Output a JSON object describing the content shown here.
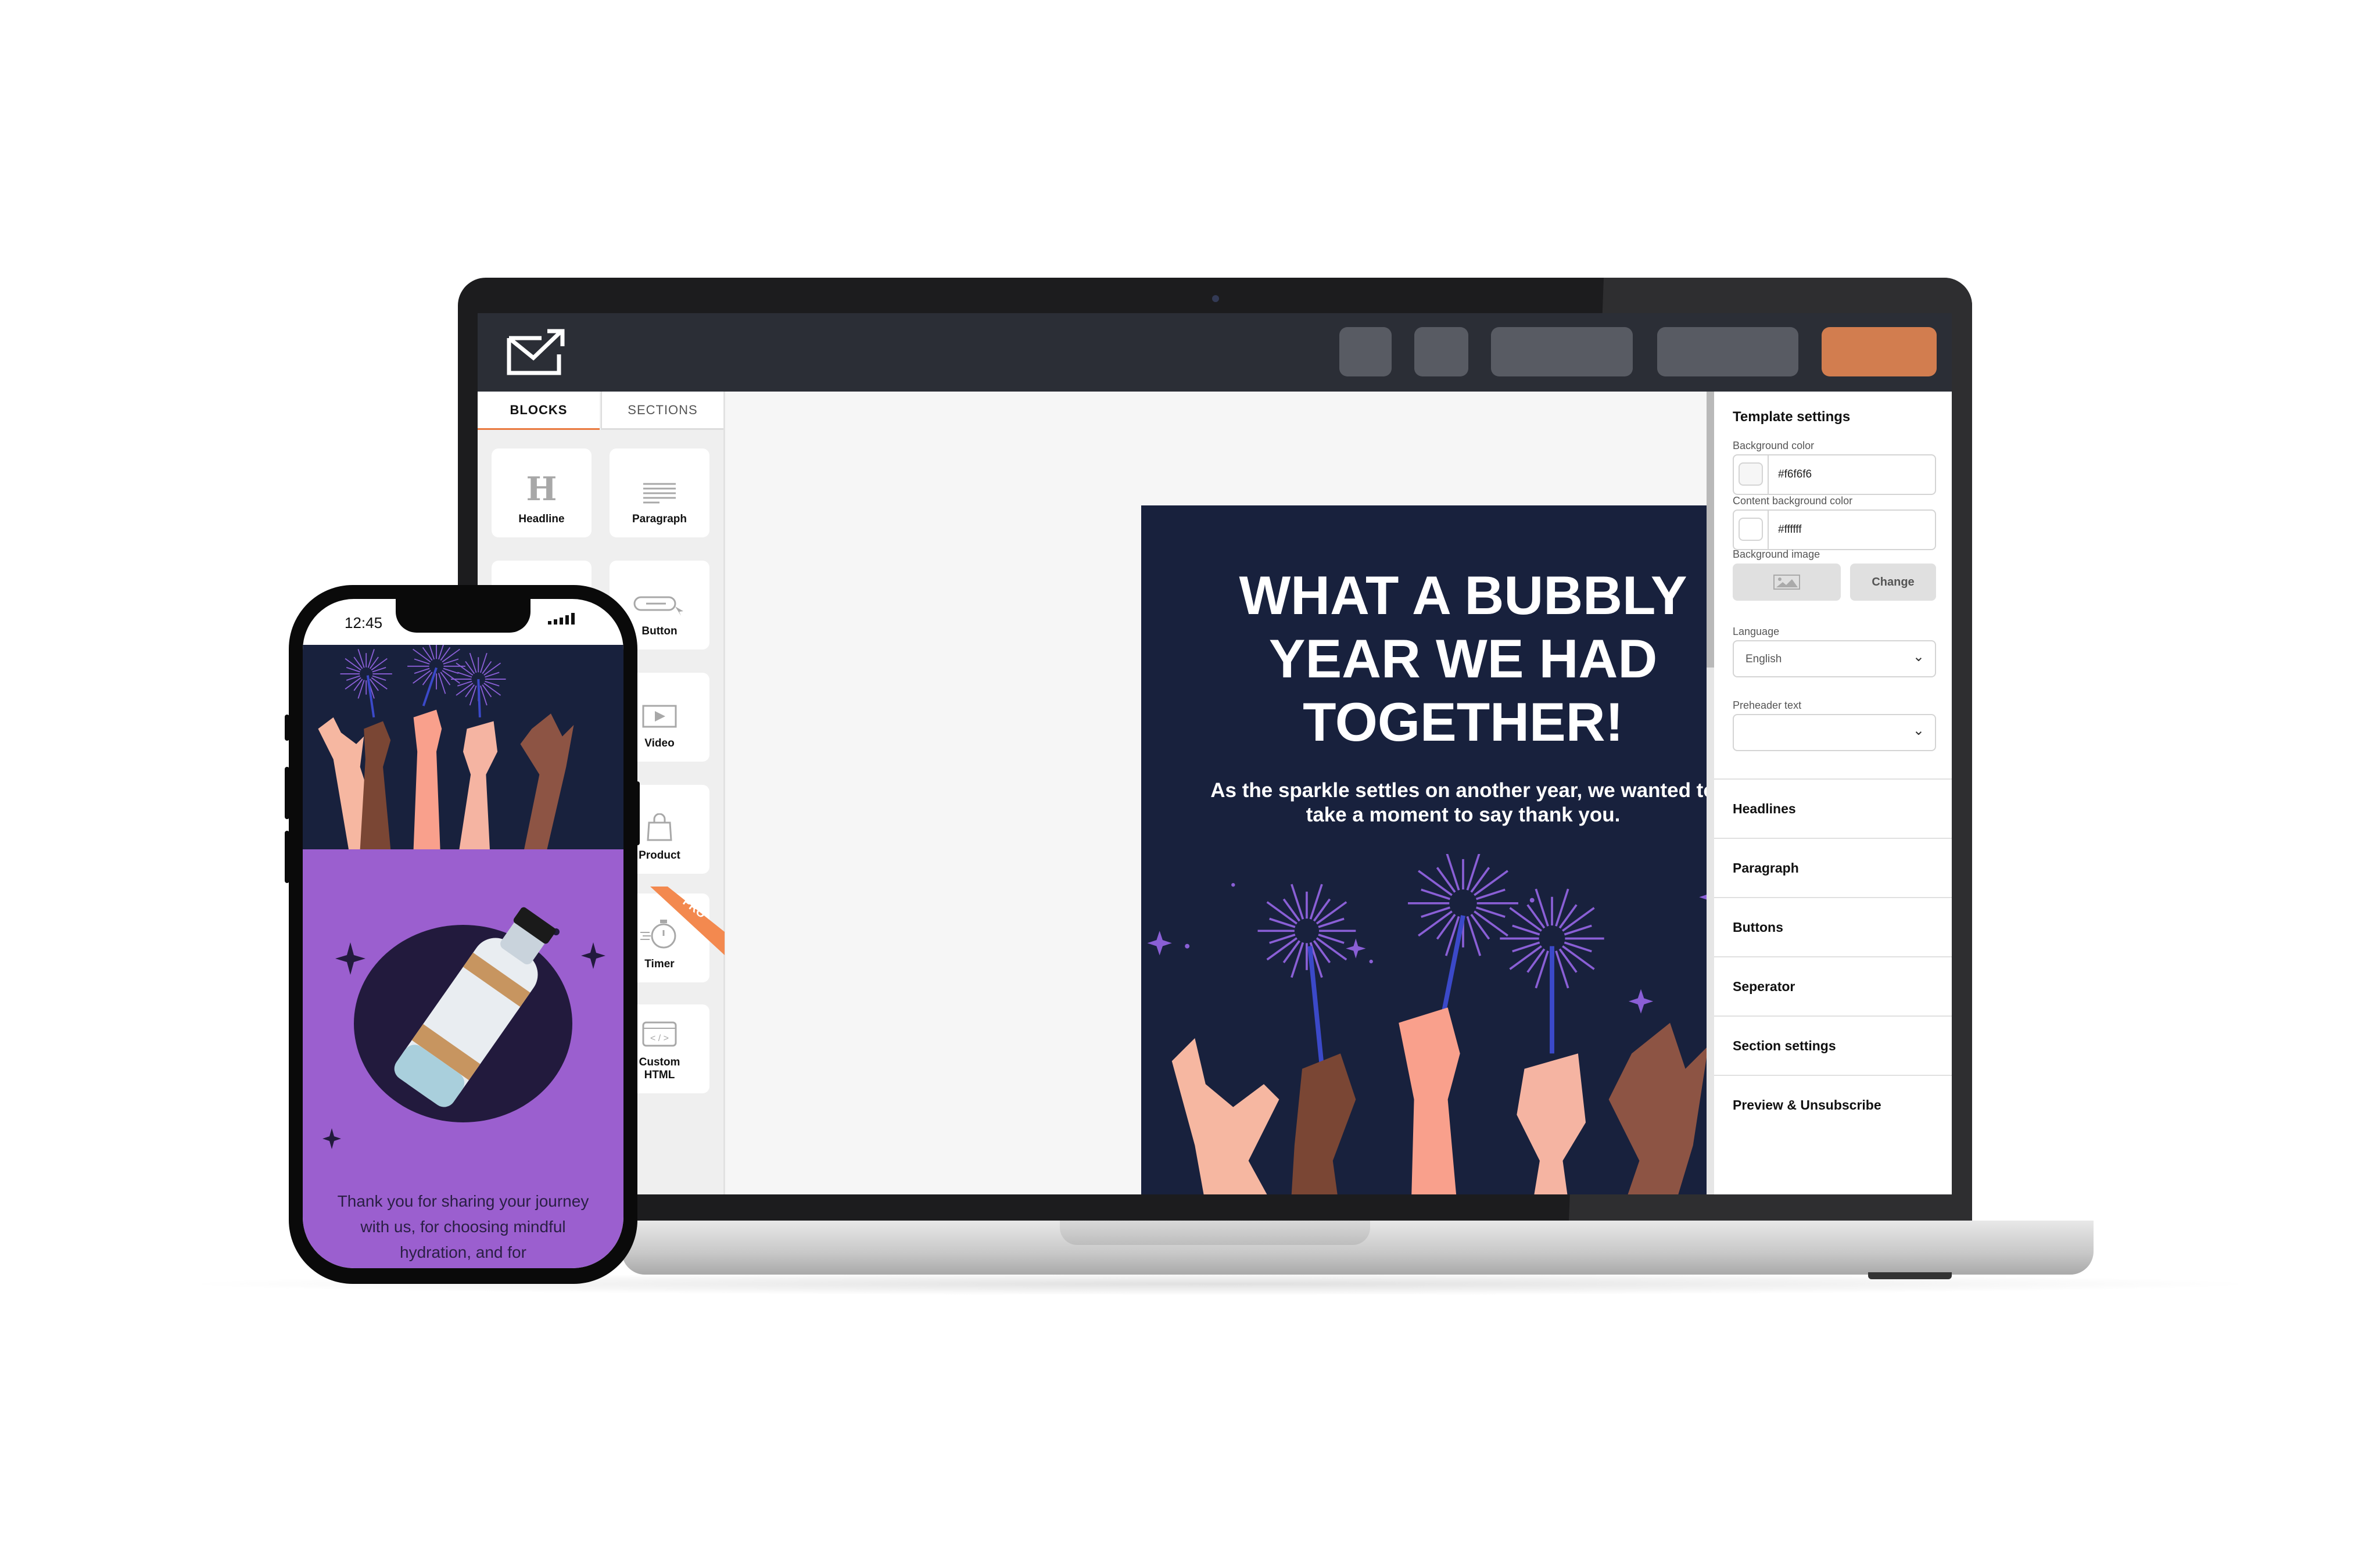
{
  "app": {
    "toolbar": {
      "buttons": [
        "",
        "",
        "",
        "",
        ""
      ],
      "accent_color": "#d27d4f"
    },
    "left_panel": {
      "tabs": [
        {
          "label": "BLOCKS",
          "active": true
        },
        {
          "label": "SECTIONS",
          "active": false
        }
      ],
      "blocks": [
        {
          "label": "Headline",
          "icon": "heading-icon"
        },
        {
          "label": "Paragraph",
          "icon": "paragraph-icon"
        },
        {
          "label": "",
          "icon": "image-icon"
        },
        {
          "label": "Button",
          "icon": "button-icon"
        },
        {
          "label": "Video",
          "icon": "video-icon"
        },
        {
          "label": "Product",
          "icon": "shopping-bag-icon"
        },
        {
          "label": "Timer",
          "icon": "stopwatch-icon",
          "badge": "PRO"
        },
        {
          "label": "Custom HTML",
          "icon": "code-icon"
        }
      ]
    },
    "email": {
      "headline": "WHAT A BUBBLY YEAR WE HAD TOGETHER!",
      "subtext": "As the sparkle settles on another year, we wanted to take a moment to say thank you.",
      "background_color": "#18213d",
      "accent_color": "#9b5fcf"
    },
    "right_panel": {
      "title": "Template settings",
      "background_color": {
        "label": "Background color",
        "value": "#f6f6f6"
      },
      "content_background_color": {
        "label": "Content background color",
        "value": "#ffffff"
      },
      "background_image": {
        "label": "Background image",
        "change_label": "Change"
      },
      "language": {
        "label": "Language",
        "value": "English"
      },
      "preheader": {
        "label": "Preheader text",
        "value": ""
      },
      "sections": [
        "Headlines",
        "Paragraph",
        "Buttons",
        "Seperator",
        "Section settings",
        "Preview & Unsubscribe"
      ]
    }
  },
  "phone": {
    "time": "12:45",
    "body_text": "Thank you for sharing your journey with us, for choosing mindful hydration, and for"
  }
}
